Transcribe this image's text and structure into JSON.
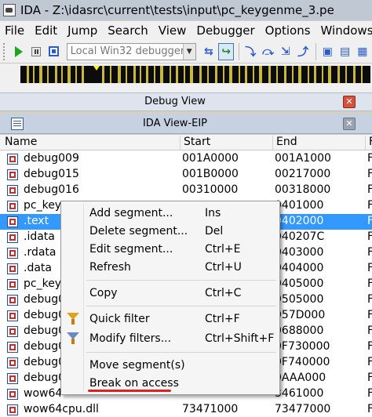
{
  "window": {
    "title": "IDA - Z:\\idasrc\\current\\tests\\input\\pc_keygenme_3.pe"
  },
  "menu": [
    "File",
    "Edit",
    "Jump",
    "Search",
    "View",
    "Debugger",
    "Options",
    "Windows"
  ],
  "toolbar": {
    "debugger_select": "Local Win32 debugger"
  },
  "panels": {
    "debug_view": "Debug View",
    "ida_view": "IDA View-EIP"
  },
  "table": {
    "columns": [
      "Name",
      "Start",
      "End",
      "F"
    ],
    "rows": [
      {
        "name": "debug009",
        "start": "001A0000",
        "end": "001A1000",
        "r": "F"
      },
      {
        "name": "debug015",
        "start": "001B0000",
        "end": "00217000",
        "r": "F"
      },
      {
        "name": "debug016",
        "start": "00310000",
        "end": "00318000",
        "r": "F"
      },
      {
        "name": "pc_keyg",
        "start": "",
        "end": "0401000",
        "r": "F"
      },
      {
        "name": ".text",
        "start": "",
        "end": "0402000",
        "r": "F",
        "selected": true
      },
      {
        "name": ".idata",
        "start": "",
        "end": "040207C",
        "r": "F"
      },
      {
        "name": ".rdata",
        "start": "",
        "end": "0403000",
        "r": "F"
      },
      {
        "name": ".data",
        "start": "",
        "end": "0404000",
        "r": "F"
      },
      {
        "name": "pc_keyg",
        "start": "",
        "end": "0405000",
        "r": "F"
      },
      {
        "name": "debug0",
        "start": "",
        "end": "0505000",
        "r": "F"
      },
      {
        "name": "debug0",
        "start": "",
        "end": "057D000",
        "r": "F"
      },
      {
        "name": "debug0",
        "start": "",
        "end": "0688000",
        "r": "F"
      },
      {
        "name": "debug0",
        "start": "",
        "end": "0F730000",
        "r": "F"
      },
      {
        "name": "debug0",
        "start": "",
        "end": "0F740000",
        "r": "F"
      },
      {
        "name": "debug0",
        "start": "",
        "end": "0AAA000",
        "r": "F"
      },
      {
        "name": "wow64",
        "start": "",
        "end": "3461000",
        "r": "F"
      },
      {
        "name": "wow64cpu.dll",
        "start": "73471000",
        "end": "73477000",
        "r": "F"
      }
    ]
  },
  "context_menu": {
    "items": [
      {
        "label": "Add segment...",
        "shortcut": "Ins"
      },
      {
        "label": "Delete segment...",
        "shortcut": "Del"
      },
      {
        "label": "Edit segment...",
        "shortcut": "Ctrl+E"
      },
      {
        "label": "Refresh",
        "shortcut": "Ctrl+U"
      },
      {
        "label": "Copy",
        "shortcut": "Ctrl+C"
      },
      {
        "label": "Quick filter",
        "shortcut": "Ctrl+F"
      },
      {
        "label": "Modify filters...",
        "shortcut": "Ctrl+Shift+F"
      },
      {
        "label": "Move segment(s)",
        "shortcut": ""
      },
      {
        "label": "Break on access",
        "shortcut": ""
      }
    ]
  },
  "colors": {
    "selection": "#3399ff",
    "nav_segment": "#c8b840",
    "annotation_underline": "#e02020"
  },
  "icons": {
    "app": "ida-app-icon",
    "segment": "segment-icon",
    "quick_filter": "funnel-icon",
    "modify_filter": "funnel-edit-icon"
  }
}
